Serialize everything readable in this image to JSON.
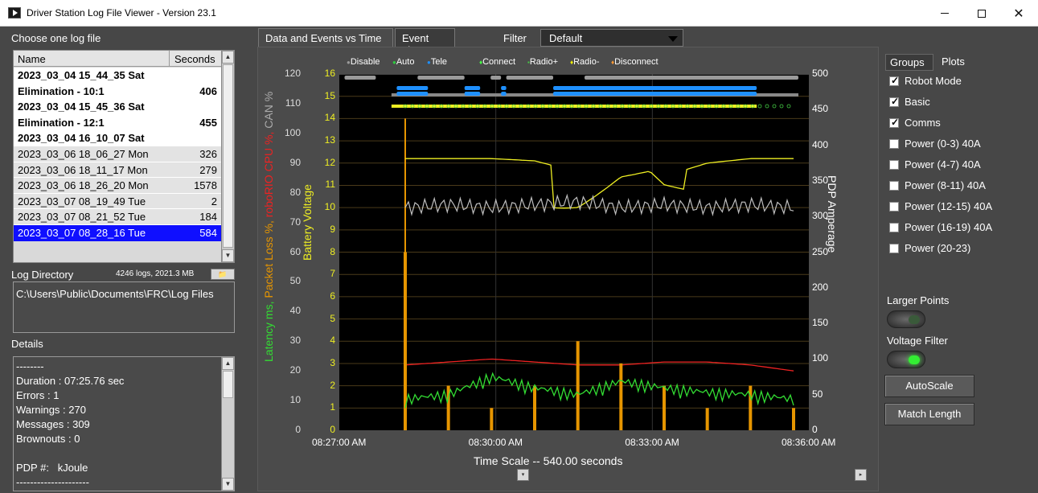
{
  "window": {
    "title": "Driver Station Log File Viewer - Version 23.1"
  },
  "left": {
    "choose_label": "Choose one log file",
    "table_headers": {
      "name": "Name",
      "seconds": "Seconds"
    },
    "files": [
      {
        "name": "2023_03_04 15_44_35 Sat",
        "seconds": "",
        "style": "white"
      },
      {
        "name": "Elimination - 10:1",
        "seconds": "406",
        "style": "white"
      },
      {
        "name": "2023_03_04 15_45_36 Sat",
        "seconds": "",
        "style": "white"
      },
      {
        "name": "Elimination - 12:1",
        "seconds": "455",
        "style": "white"
      },
      {
        "name": "2023_03_04 16_10_07 Sat",
        "seconds": "",
        "style": "white"
      },
      {
        "name": "2023_03_06 18_06_27 Mon",
        "seconds": "326",
        "style": "grey"
      },
      {
        "name": "2023_03_06 18_11_17 Mon",
        "seconds": "279",
        "style": "grey"
      },
      {
        "name": "2023_03_06 18_26_20 Mon",
        "seconds": "1578",
        "style": "grey"
      },
      {
        "name": "2023_03_07 08_19_49 Tue",
        "seconds": "2",
        "style": "grey"
      },
      {
        "name": "2023_03_07 08_21_52 Tue",
        "seconds": "184",
        "style": "grey"
      },
      {
        "name": "2023_03_07 08_28_16 Tue",
        "seconds": "584",
        "style": "sel"
      }
    ],
    "log_directory_label": "Log Directory",
    "log_stats": "4246 logs, 2021.3 MB",
    "log_directory_path": "C:\\Users\\Public\\Documents\\FRC\\Log Files",
    "details_label": "Details",
    "details_lines": [
      "--------",
      "Duration : 07:25.76 sec",
      "Errors : 1",
      "Warnings : 270",
      "Messages : 309",
      "Brownouts : 0",
      "",
      "PDP #:   kJoule",
      "---------------------"
    ]
  },
  "tabs": {
    "active": "Data and Events vs Time",
    "inactive": "Event List"
  },
  "filter": {
    "label": "Filter",
    "value": "Default"
  },
  "legend": [
    {
      "label": "Disable",
      "color": "#9a9a9a",
      "glyph": "dot"
    },
    {
      "label": "Auto",
      "color": "#2ecc40",
      "glyph": "dot"
    },
    {
      "label": "Tele",
      "color": "#1e90ff",
      "glyph": "dot"
    },
    {
      "label": "Connect",
      "color": "#44ff44",
      "glyph": "diamond"
    },
    {
      "label": "Radio+",
      "color": "#44cc44",
      "glyph": "square"
    },
    {
      "label": "Radio-",
      "color": "#eeee00",
      "glyph": "diamond"
    },
    {
      "label": "Disconnect",
      "color": "#ff9933",
      "glyph": "diamond"
    }
  ],
  "chart_data": {
    "type": "line",
    "title": "",
    "xlabel": "Time Scale -- 540.00 seconds",
    "x_ticks": [
      "08:27:00 AM",
      "08:30:00 AM",
      "08:33:00 AM",
      "08:36:00 AM"
    ],
    "xlim": [
      "08:27:00 AM",
      "08:36:00 AM"
    ],
    "left_axis_outer": {
      "label": "CAN %",
      "ticks": [
        0,
        10,
        20,
        30,
        40,
        50,
        60,
        70,
        80,
        90,
        100,
        110,
        120
      ],
      "color": "#bfbfbf"
    },
    "left_axis_inner": {
      "label": "Battery Voltage",
      "ticks": [
        0,
        1,
        2,
        3,
        4,
        5,
        6,
        7,
        8,
        9,
        10,
        11,
        12,
        13,
        14,
        15,
        16
      ],
      "color": "#eeee22"
    },
    "left_axis_labels": [
      {
        "text": "Latency ms,",
        "color": "#33dd33"
      },
      {
        "text": "Packet Loss %,",
        "color": "#e69500"
      },
      {
        "text": "roboRIO CPU %,",
        "color": "#ee2222"
      },
      {
        "text": "CAN %",
        "color": "#aaaaaa"
      }
    ],
    "right_axis": {
      "label": "PDP Amperage",
      "ticks": [
        0,
        50,
        100,
        150,
        200,
        250,
        300,
        350,
        400,
        450,
        500
      ],
      "color": "#ffffff"
    },
    "mode_bars": {
      "disable": [
        [
          "08:27:06 AM",
          "08:27:42 AM"
        ],
        [
          "08:28:30 AM",
          "08:29:24 AM"
        ],
        [
          "08:29:54 AM",
          "08:30:06 AM"
        ],
        [
          "08:30:12 AM",
          "08:31:06 AM"
        ],
        [
          "08:31:42 AM",
          "08:35:48 AM"
        ]
      ],
      "tele": [
        [
          "08:28:06 AM",
          "08:28:42 AM"
        ],
        [
          "08:29:24 AM",
          "08:29:42 AM"
        ],
        [
          "08:30:06 AM",
          "08:30:12 AM"
        ],
        [
          "08:31:06 AM",
          "08:35:00 AM"
        ]
      ],
      "disable_row2": [
        [
          "08:28:00 AM",
          "08:35:48 AM"
        ]
      ],
      "radio_minus_band": [
        [
          "08:28:00 AM",
          "08:35:00 AM"
        ]
      ]
    },
    "series": [
      {
        "name": "Battery Voltage",
        "color": "#eeee22",
        "values": [
          12.2,
          12.2,
          12.2,
          12.1,
          11.6,
          12.1,
          11.4,
          12.0,
          12.2,
          12.2
        ]
      },
      {
        "name": "CAN %",
        "color": "#bfbfbf",
        "values": [
          75,
          76,
          75,
          76,
          77,
          75,
          76,
          75,
          76,
          75
        ]
      },
      {
        "name": "roboRIO CPU %",
        "color": "#ee2222",
        "values": [
          22,
          23,
          24,
          23,
          22,
          22,
          23,
          23,
          22,
          20
        ]
      },
      {
        "name": "Packet Loss %",
        "color": "#e69500",
        "values": [
          8,
          2,
          1,
          2,
          4,
          3,
          2,
          1,
          2,
          1
        ]
      },
      {
        "name": "Latency ms",
        "color": "#33dd33",
        "values": [
          1,
          1.2,
          2,
          1.5,
          1.2,
          1.8,
          1.5,
          1.3,
          1.2,
          1.0
        ]
      }
    ]
  },
  "right": {
    "tabs": {
      "groups": "Groups",
      "plots": "Plots"
    },
    "checkboxes": [
      {
        "label": "Robot Mode",
        "checked": true
      },
      {
        "label": "Basic",
        "checked": true
      },
      {
        "label": "Comms",
        "checked": true
      },
      {
        "label": "Power (0-3) 40A",
        "checked": false
      },
      {
        "label": "Power (4-7) 40A",
        "checked": false
      },
      {
        "label": "Power (8-11) 40A",
        "checked": false
      },
      {
        "label": "Power (12-15) 40A",
        "checked": false
      },
      {
        "label": "Power (16-19) 40A",
        "checked": false
      },
      {
        "label": "Power (20-23)",
        "checked": false
      }
    ],
    "larger_points_label": "Larger Points",
    "voltage_filter_label": "Voltage Filter",
    "larger_points_on": false,
    "voltage_filter_on": true,
    "autoscale_label": "AutoScale",
    "match_length_label": "Match Length"
  }
}
